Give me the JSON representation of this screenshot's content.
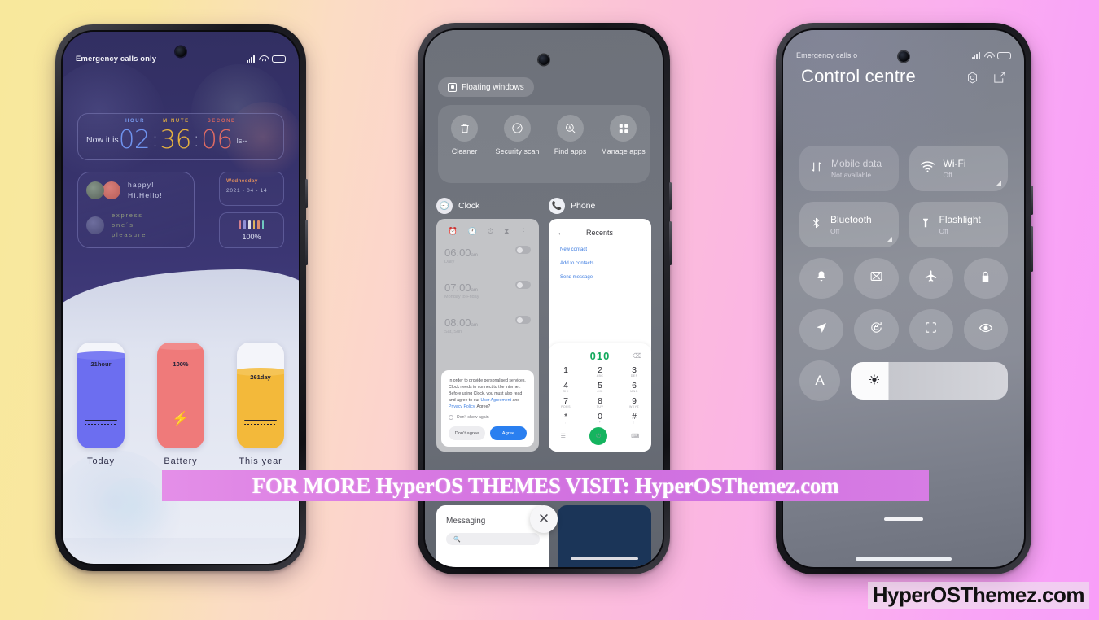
{
  "background": {
    "left_color": "#f8e89c",
    "mid_color": "#fbdcc4",
    "right_color": "#f89ef8"
  },
  "banner": {
    "text": "FOR MORE HyperOS THEMES VISIT: HyperOSThemez.com",
    "bg_color": "#d77ce4"
  },
  "watermark": {
    "text": "HyperOSThemez.com"
  },
  "phone1": {
    "statusbar": {
      "carrier": "Emergency calls only"
    },
    "clock_widget": {
      "prefix": "Now it is",
      "labels": {
        "hour": "HOUR",
        "minute": "MINUTE",
        "second": "SECOND"
      },
      "hour": "02",
      "minute": "36",
      "second": "06",
      "sep": ":",
      "suffix": "ls--",
      "hour_color": "#6f93ef",
      "minute_color": "#e6b23f",
      "second_color": "#e06b63"
    },
    "greeting_card": {
      "line1": "happy!",
      "line2": "Hi.Hello!",
      "line3": "express",
      "line4": "one´s",
      "line5": "pleasure"
    },
    "date_card": {
      "weekday": "Wednesday",
      "date": "2021 - 04 - 14"
    },
    "battery_card": {
      "percent": "100%"
    },
    "tiles": [
      {
        "value": "21hour",
        "label": "Today",
        "color": "#6c6ef0",
        "fill": 88
      },
      {
        "value": "100%",
        "label": "Battery",
        "color": "#ef7a7a",
        "fill": 97
      },
      {
        "value": "261day",
        "label": "This year",
        "color": "#f3b93a",
        "fill": 72
      }
    ]
  },
  "phone2": {
    "floating_chip": {
      "label": "Floating windows"
    },
    "quick_actions": [
      {
        "label": "Cleaner",
        "icon": "trash-icon"
      },
      {
        "label": "Security scan",
        "icon": "gauge-icon"
      },
      {
        "label": "Find apps",
        "icon": "search-circle-icon"
      },
      {
        "label": "Manage apps",
        "icon": "grid-icon"
      }
    ],
    "recent_cards": [
      {
        "title": "Clock",
        "icon": "clock-app-icon"
      },
      {
        "title": "Phone",
        "icon": "phone-app-icon"
      }
    ],
    "clock_app": {
      "toolbar": [
        "alarm",
        "clock",
        "timer",
        "stopwatch",
        "more"
      ],
      "alarms": [
        {
          "time": "06:00",
          "meridiem": "am",
          "repeat": "Daily"
        },
        {
          "time": "07:00",
          "meridiem": "am",
          "repeat": "Monday to Friday"
        },
        {
          "time": "08:00",
          "meridiem": "am",
          "repeat": "Sat, Sun"
        }
      ],
      "dialog": {
        "body_1": "In order to provide personalised services, Clock needs to connect to the internet. Before using Clock, you must also read and agree to our ",
        "link_1": "User Agreement",
        "body_2": " and ",
        "link_2": "Privacy Policy",
        "body_3": ". Agree?",
        "checkbox": "Don't show again",
        "decline": "Don't agree",
        "accept": "Agree"
      }
    },
    "phone_app": {
      "title": "Recents",
      "links": [
        "New contact",
        "Add to contacts",
        "Send message"
      ],
      "dialed": "010",
      "keys": [
        {
          "d": "1",
          "s": ""
        },
        {
          "d": "2",
          "s": "ABC"
        },
        {
          "d": "3",
          "s": "DEF"
        },
        {
          "d": "4",
          "s": "GHI"
        },
        {
          "d": "5",
          "s": "JKL"
        },
        {
          "d": "6",
          "s": "MNO"
        },
        {
          "d": "7",
          "s": "PQRS"
        },
        {
          "d": "8",
          "s": "TUV"
        },
        {
          "d": "9",
          "s": "WXYZ"
        },
        {
          "d": "*",
          "s": ","
        },
        {
          "d": "0",
          "s": "+"
        },
        {
          "d": "#",
          "s": ";"
        }
      ]
    },
    "messaging_card": {
      "title": "Messaging",
      "search_placeholder": ""
    },
    "close_button": {
      "label": "✕"
    }
  },
  "phone3": {
    "statusbar": {
      "carrier": "Emergency calls o"
    },
    "title": "Control centre",
    "header_actions": [
      {
        "name": "settings-gear-icon"
      },
      {
        "name": "edit-icon"
      }
    ],
    "big_tiles": [
      {
        "title": "Mobile data",
        "status": "Not available",
        "icon": "mobile-data-icon",
        "enabled": false
      },
      {
        "title": "Wi-Fi",
        "status": "Off",
        "icon": "wifi-icon",
        "enabled": true
      },
      {
        "title": "Bluetooth",
        "status": "Off",
        "icon": "bluetooth-icon",
        "enabled": true
      },
      {
        "title": "Flashlight",
        "status": "Off",
        "icon": "flashlight-icon",
        "enabled": true
      }
    ],
    "round_toggles": [
      {
        "icon": "bell-icon"
      },
      {
        "icon": "screenshot-icon"
      },
      {
        "icon": "airplane-icon"
      },
      {
        "icon": "lock-icon"
      },
      {
        "icon": "location-icon"
      },
      {
        "icon": "rotation-lock-icon"
      },
      {
        "icon": "scan-icon"
      },
      {
        "icon": "eye-icon"
      }
    ],
    "brightness": {
      "auto_label": "A",
      "icon": "sun-icon",
      "value": 24
    }
  }
}
